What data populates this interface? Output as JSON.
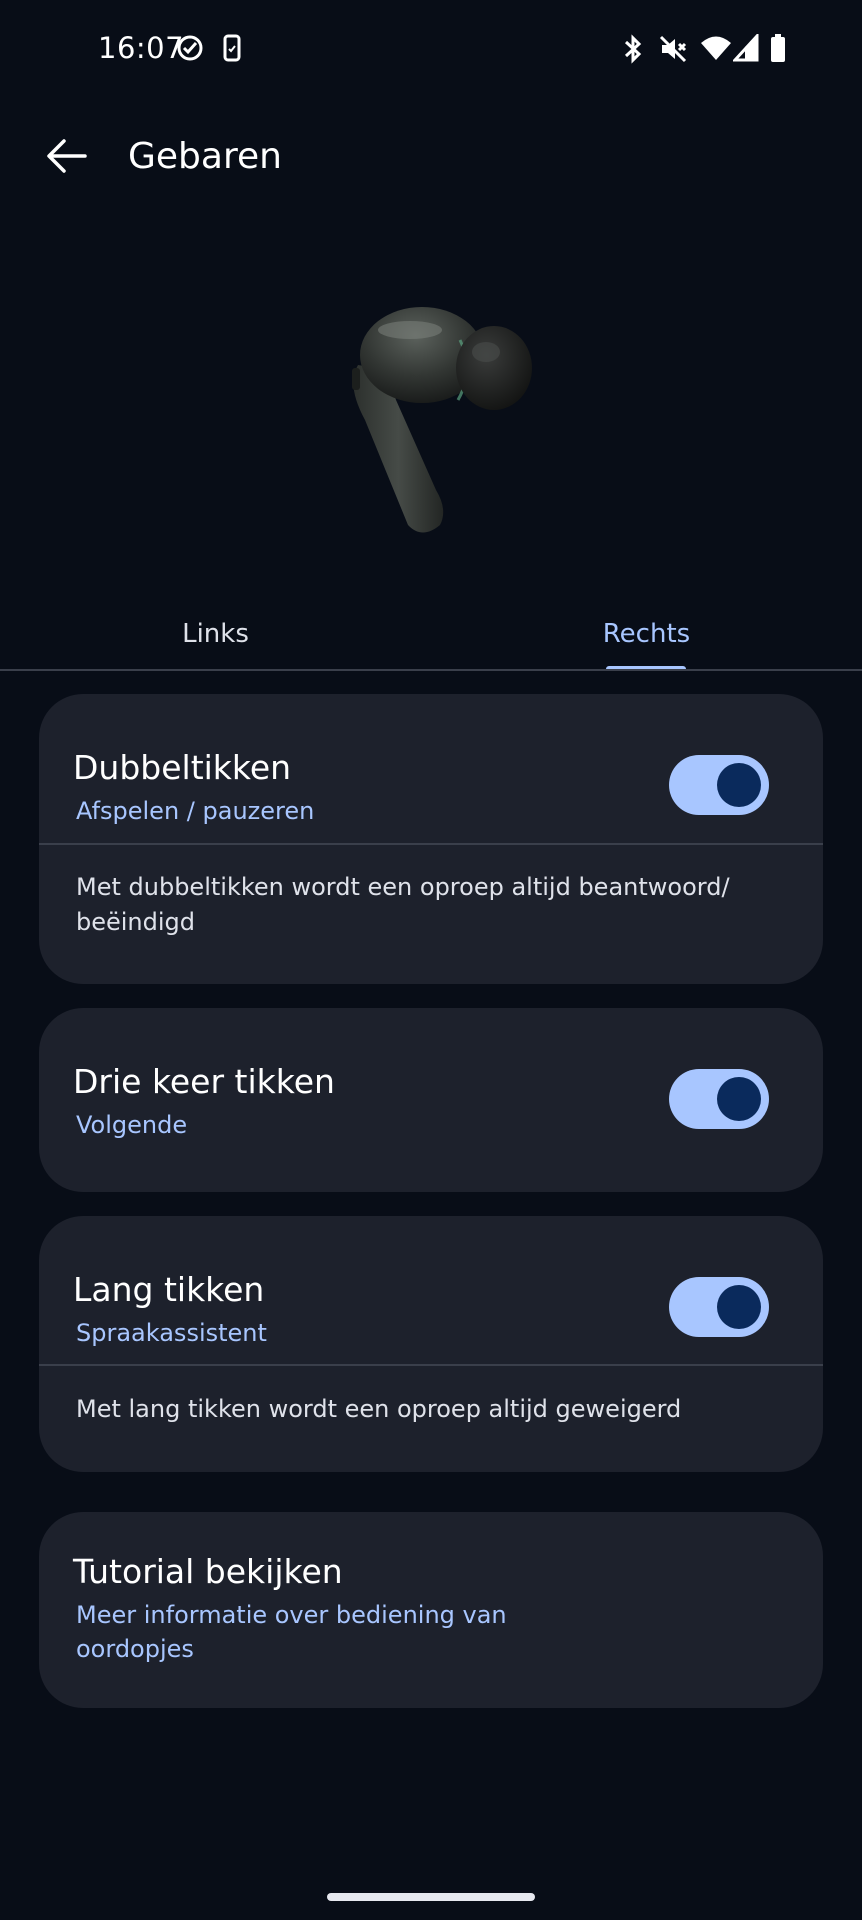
{
  "status_bar": {
    "time": "16:07",
    "left_icons": [
      "check-circle-icon",
      "phone-icon"
    ],
    "right_icons": [
      "bluetooth-icon",
      "mute-icon",
      "wifi-icon",
      "signal-icon",
      "battery-icon"
    ]
  },
  "app_bar": {
    "back_icon": "arrow-left-icon",
    "title": "Gebaren"
  },
  "tabs": [
    {
      "label": "Links",
      "selected": false
    },
    {
      "label": "Rechts",
      "selected": true
    }
  ],
  "gestures": [
    {
      "title": "Dubbeltikken",
      "action": "Afspelen / pauzeren",
      "enabled": true,
      "note": "Met dubbeltikken wordt een oproep altijd beantwoord/ beëindigd"
    },
    {
      "title": "Drie keer tikken",
      "action": "Volgende",
      "enabled": true
    },
    {
      "title": "Lang tikken",
      "action": "Spraakassistent",
      "enabled": true,
      "note": "Met lang tikken wordt een oproep altijd geweigerd"
    }
  ],
  "tutorial": {
    "title": "Tutorial bekijken",
    "subtitle": "Meer informatie over bediening van oordopjes"
  },
  "colors": {
    "background": "#080d17",
    "card": "#1d212c",
    "accent": "#a8c6ff",
    "toggle_knob": "#0a2a5c"
  }
}
